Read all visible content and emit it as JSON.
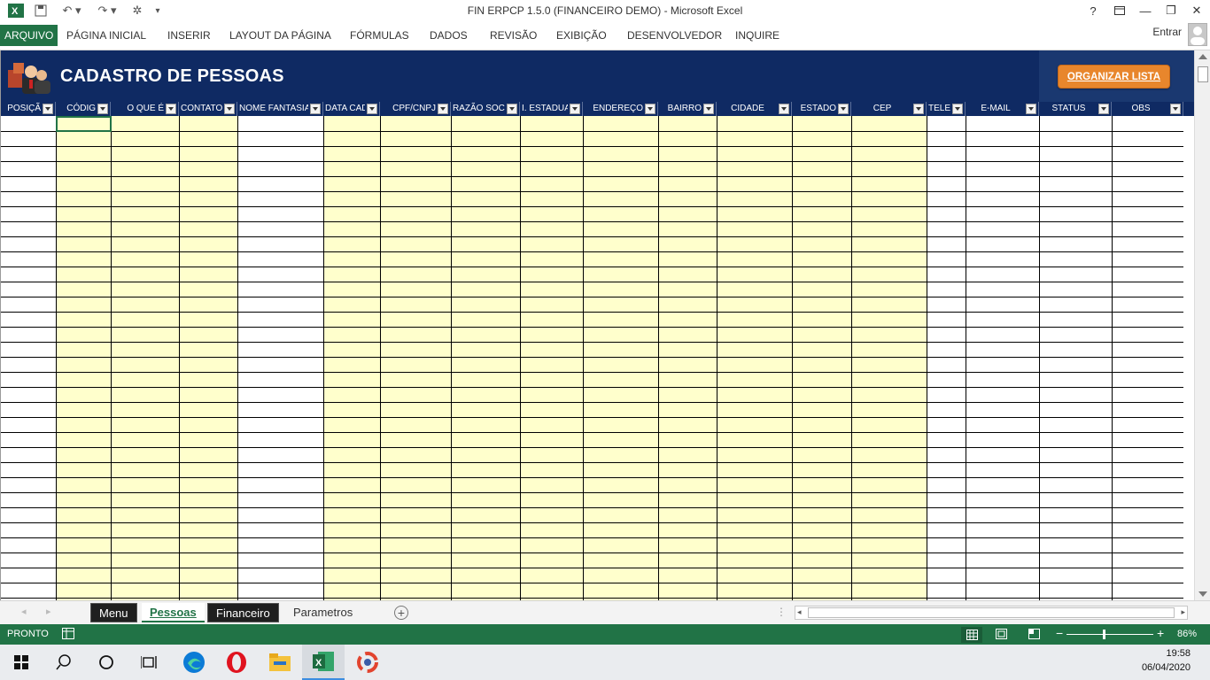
{
  "window": {
    "title": "FIN ERPCP 1.5.0 (FINANCEIRO DEMO) - Microsoft Excel"
  },
  "titlebar": {
    "help": "?",
    "minimize": "—",
    "restore": "❐",
    "close": "✕"
  },
  "ribbon": {
    "tabs": [
      "ARQUIVO",
      "PÁGINA INICIAL",
      "INSERIR",
      "LAYOUT DA PÁGINA",
      "FÓRMULAS",
      "DADOS",
      "REVISÃO",
      "EXIBIÇÃO",
      "DESENVOLVEDOR",
      "INQUIRE"
    ],
    "signin": "Entrar"
  },
  "sheet": {
    "title": "CADASTRO DE PESSOAS",
    "organize_button": "ORGANIZAR LISTA",
    "columns": [
      "POSIÇÃ",
      "CÓDIG",
      "O QUE É",
      "CONTATO",
      "NOME FANTASIA",
      "DATA CAD",
      "CPF/CNPJ",
      "RAZÃO SOCIA",
      "I. ESTADUAI",
      "ENDEREÇO",
      "BAIRRO",
      "CIDADE",
      "ESTADO",
      "CEP",
      "TELEF",
      "E-MAIL",
      "STATUS",
      "OBS"
    ]
  },
  "sheet_tabs": [
    "Menu",
    "Pessoas",
    "Financeiro",
    "Parametros"
  ],
  "status": {
    "ready": "PRONTO",
    "zoom": "86%"
  },
  "taskbar": {
    "time": "19:58",
    "date": "06/04/2020"
  },
  "colors": {
    "excel_green": "#217346",
    "banner_blue": "#0f2a63",
    "input_yellow": "#ffffcc",
    "button_orange": "#e8862c"
  }
}
